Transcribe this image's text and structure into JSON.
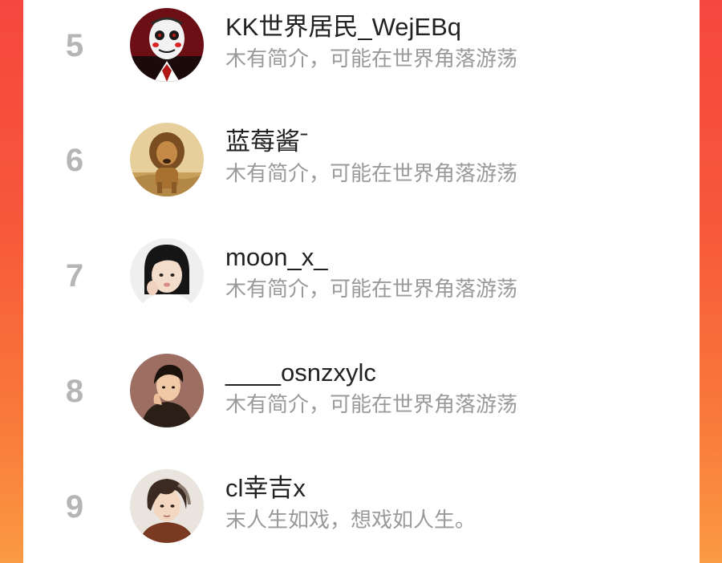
{
  "ranking": {
    "items": [
      {
        "rank": "5",
        "name": "KK世界居民_WejEBq",
        "bio": "木有简介，可能在世界角落游荡",
        "avatar": "jigsaw-mask-avatar"
      },
      {
        "rank": "6",
        "name": "蓝莓酱ˉ",
        "bio": "木有简介，可能在世界角落游荡",
        "avatar": "lion-avatar"
      },
      {
        "rank": "7",
        "name": "moon_x_",
        "bio": "木有简介，可能在世界角落游荡",
        "avatar": "girl-photo-avatar"
      },
      {
        "rank": "8",
        "name": "____osnzxylc",
        "bio": "木有简介，可能在世界角落游荡",
        "avatar": "illustrated-man-avatar"
      },
      {
        "rank": "9",
        "name": "cl幸吉x",
        "bio": "末人生如戏，想戏如人生。",
        "avatar": "anime-boy-avatar"
      }
    ]
  }
}
